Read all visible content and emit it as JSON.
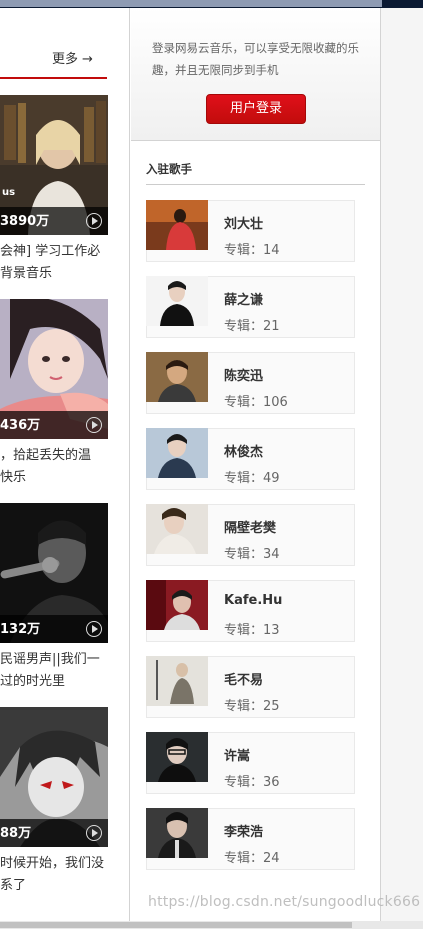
{
  "header": {
    "more_label": "更多",
    "more_icon": "arrow-right-icon"
  },
  "playlists": [
    {
      "count": "3890万",
      "desc_line1": "会神] 学习工作必",
      "desc_line2": "背景音乐",
      "cover_text": "us"
    },
    {
      "count": "436万",
      "desc_line1": "，拾起丢失的温",
      "desc_line2": "快乐"
    },
    {
      "count": "132万",
      "desc_line1": "民谣男声||我们一",
      "desc_line2": "过的时光里"
    },
    {
      "count": "88万",
      "desc_line1": "时候开始，我们没",
      "desc_line2": "系了"
    }
  ],
  "login": {
    "text": "登录网易云音乐，可以享受无限收藏的乐趣，并且无限同步到手机",
    "button": "用户登录"
  },
  "singers_section": {
    "title": "入驻歌手"
  },
  "singers": [
    {
      "name": "刘大壮",
      "albums": "专辑：14"
    },
    {
      "name": "薛之谦",
      "albums": "专辑：21"
    },
    {
      "name": "陈奕迅",
      "albums": "专辑：106"
    },
    {
      "name": "林俊杰",
      "albums": "专辑：49"
    },
    {
      "name": "隔壁老樊",
      "albums": "专辑：34"
    },
    {
      "name": "Kafe.Hu",
      "albums": "专辑：13"
    },
    {
      "name": "毛不易",
      "albums": "专辑：25"
    },
    {
      "name": "许嵩",
      "albums": "专辑：36"
    },
    {
      "name": "李荣浩",
      "albums": "专辑：24"
    }
  ],
  "watermark": "https://blog.csdn.net/sungoodluck666"
}
